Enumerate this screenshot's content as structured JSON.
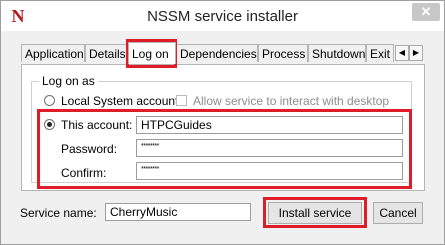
{
  "window": {
    "title": "NSSM service installer",
    "icon_glyph": "N",
    "close_glyph": "✕"
  },
  "tabs": [
    {
      "label": "Application",
      "active": false
    },
    {
      "label": "Details",
      "active": false
    },
    {
      "label": "Log on",
      "active": true
    },
    {
      "label": "Dependencies",
      "active": false
    },
    {
      "label": "Process",
      "active": false
    },
    {
      "label": "Shutdown",
      "active": false
    },
    {
      "label": "Exit",
      "active": false
    }
  ],
  "tab_scroll": {
    "left_glyph": "◀",
    "right_glyph": "▶"
  },
  "logon": {
    "group_title": "Log on as",
    "local_system_label": "Local System account",
    "local_system_selected": false,
    "interact_desktop_label": "Allow service to interact with desktop",
    "interact_desktop_checked": false,
    "this_account_label": "This account:",
    "this_account_selected": true,
    "account_value": "HTPCGuides",
    "password_label": "Password:",
    "password_value": "********",
    "confirm_label": "Confirm:",
    "confirm_value": "********"
  },
  "footer": {
    "service_name_label": "Service name:",
    "service_name_value": "CherryMusic",
    "install_label": "Install service",
    "cancel_label": "Cancel"
  },
  "annotation_color": "#e01b2a"
}
